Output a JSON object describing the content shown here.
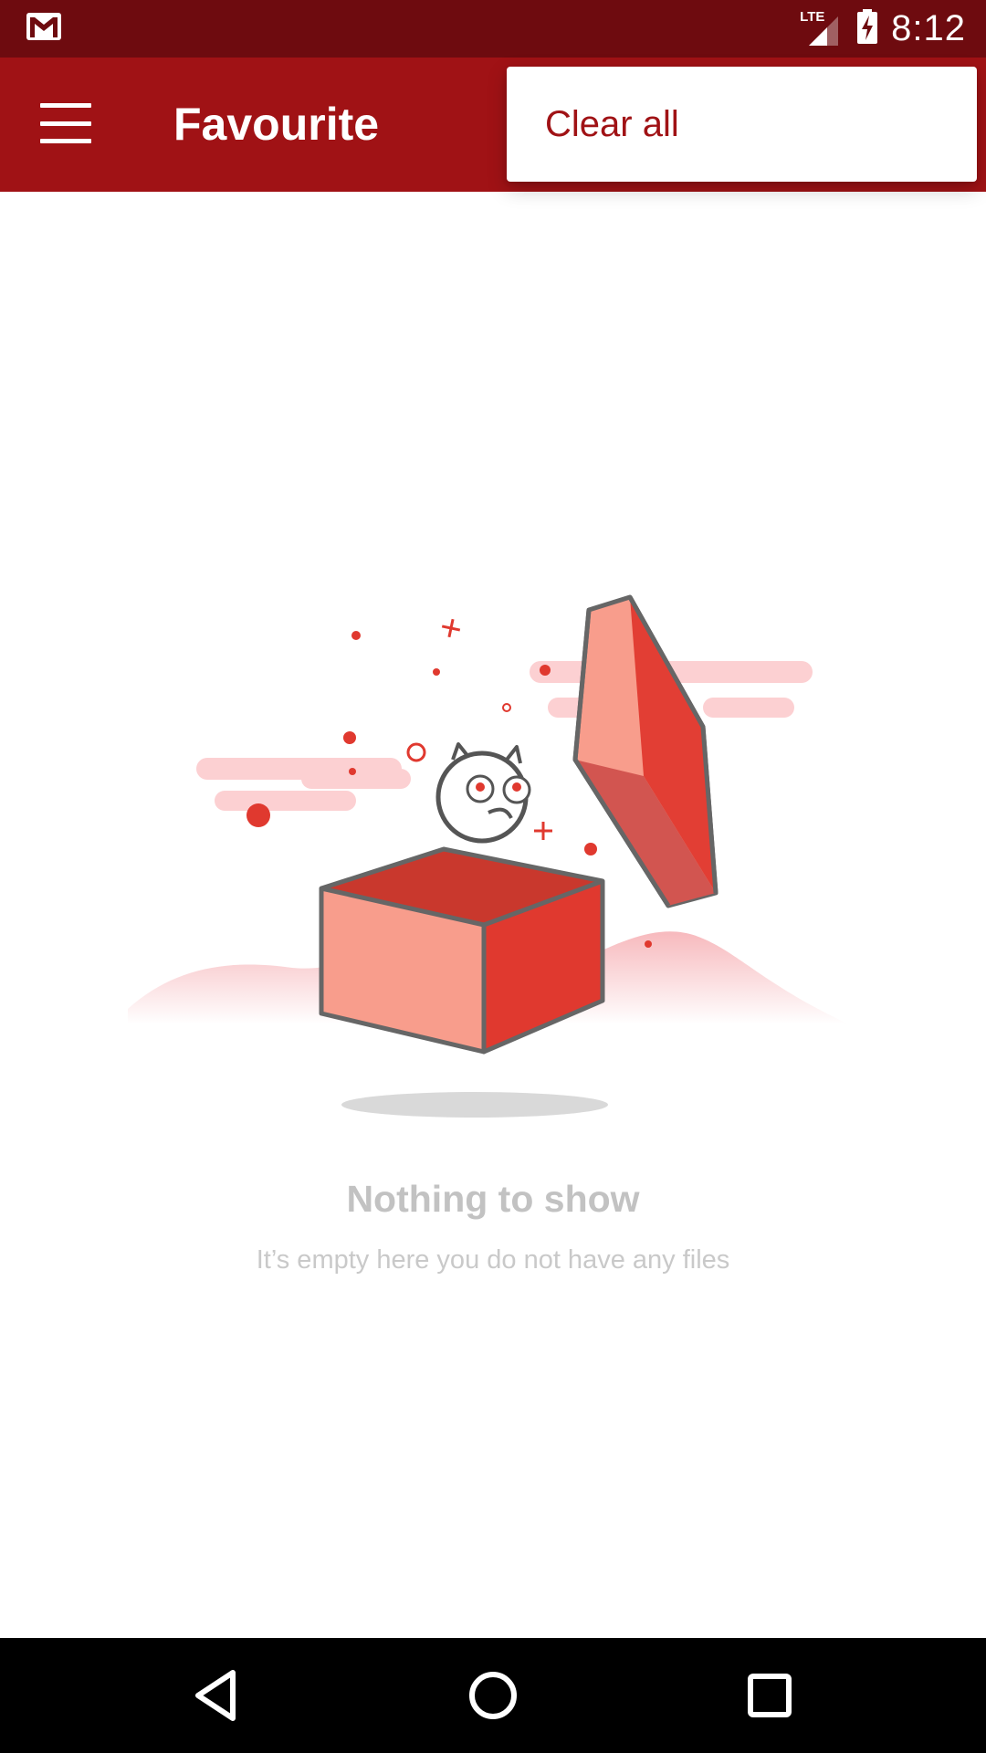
{
  "status_bar": {
    "time": "8:12",
    "network_label": "LTE",
    "icons": [
      "gmail-icon",
      "signal-icon",
      "battery-charging-icon"
    ]
  },
  "app_bar": {
    "title": "Favourite",
    "menu_icon": "hamburger-menu-icon"
  },
  "overflow_menu": {
    "items": [
      {
        "label": "Clear all"
      }
    ]
  },
  "empty_state": {
    "title": "Nothing to show",
    "subtitle": "It’s empty here you do not have any files",
    "illustration": "jack-in-the-box-illustration"
  },
  "nav_bar": {
    "icons": [
      "back-icon",
      "home-icon",
      "recents-icon"
    ]
  },
  "colors": {
    "status_bar": "#6e0b0f",
    "app_bar": "#a01215",
    "accent": "#a01215",
    "illustration_red": "#e0392f",
    "illustration_pink": "#f89d8c"
  }
}
